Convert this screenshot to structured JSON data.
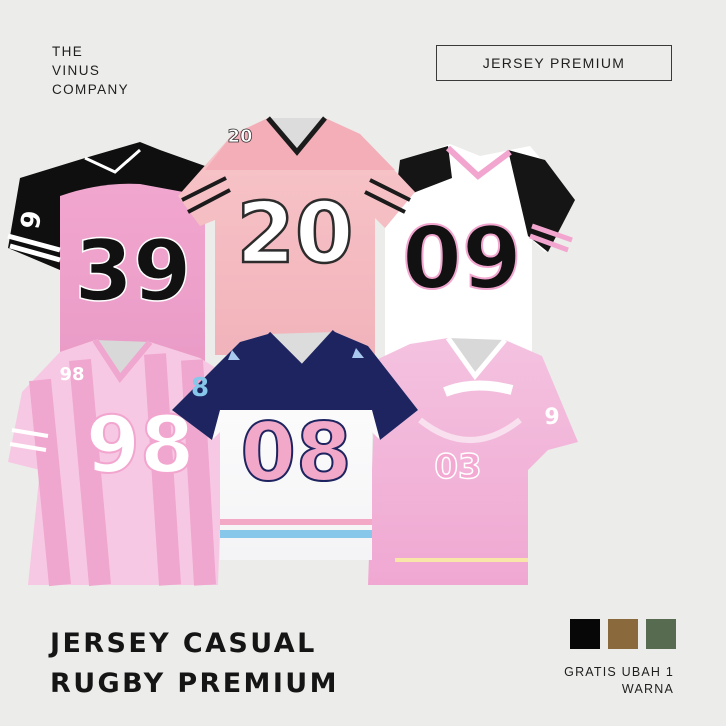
{
  "brand": {
    "line1": "THE",
    "line2": "VINUS",
    "line3": "COMPANY"
  },
  "tag": {
    "label": "JERSEY PREMIUM"
  },
  "jerseys": [
    {
      "number": "39",
      "sleeve_number": "9"
    },
    {
      "number": "20",
      "shoulder_number": "20"
    },
    {
      "number": "09"
    },
    {
      "number": "98",
      "shoulder_number": "98"
    },
    {
      "number": "08",
      "sleeve_number": "8"
    },
    {
      "number": "03",
      "sleeve_number": "9"
    }
  ],
  "headline": {
    "line1": "JERSEY CASUAL",
    "line2": "RUGBY PREMIUM"
  },
  "swatches": [
    {
      "name": "black",
      "color": "#070707"
    },
    {
      "name": "brown",
      "color": "#8a6a3d"
    },
    {
      "name": "olive-green",
      "color": "#566b50"
    }
  ],
  "note": {
    "line1": "GRATIS UBAH 1",
    "line2": "WARNA"
  }
}
